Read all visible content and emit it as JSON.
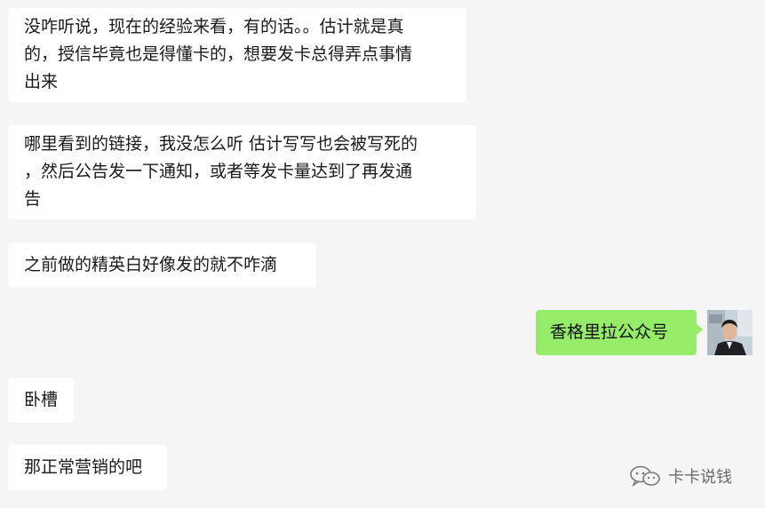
{
  "messages": [
    {
      "direction": "incoming",
      "text": "没咋听说，现在的经验来看，有的话。。估计就是真\n的，授信毕竟也是得懂卡的，想要发卡总得弄点事情\n出来"
    },
    {
      "direction": "incoming",
      "text": "哪里看到的链接，我没怎么听  估计写写也会被写死的\n，然后公告发一下通知，或者等发卡量达到了再发通\n告"
    },
    {
      "direction": "incoming",
      "text": "之前做的精英白好像发的就不咋滴"
    },
    {
      "direction": "outgoing",
      "text": "香格里拉公众号"
    },
    {
      "direction": "incoming",
      "text": "卧槽"
    },
    {
      "direction": "incoming",
      "text": "那正常营销的吧"
    }
  ],
  "watermark": {
    "icon": "wechat-icon",
    "text": "卡卡说钱"
  },
  "colors": {
    "background": "#f5f5f5",
    "incoming_bubble": "#ffffff",
    "outgoing_bubble": "#95ec69"
  }
}
